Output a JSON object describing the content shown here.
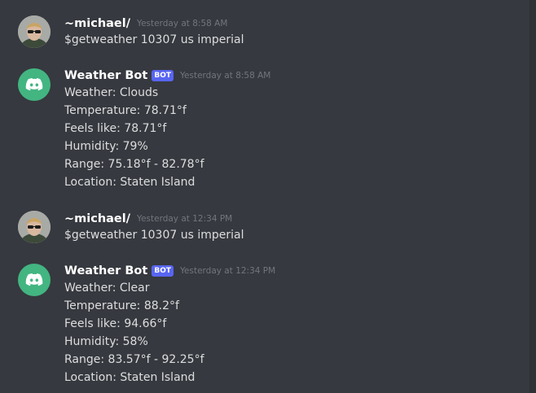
{
  "messages": [
    {
      "author": "~michael/",
      "timestamp": "Yesterday at 8:58 AM",
      "lines": [
        "$getweather 10307 us imperial"
      ]
    },
    {
      "author": "Weather Bot",
      "badge": "BOT",
      "timestamp": "Yesterday at 8:58 AM",
      "lines": [
        "Weather: Clouds",
        "Temperature: 78.71°f",
        "Feels like: 78.71°f",
        "Humidity: 79%",
        "Range: 75.18°f - 82.78°f",
        "Location: Staten Island"
      ]
    },
    {
      "author": "~michael/",
      "timestamp": "Yesterday at 12:34 PM",
      "lines": [
        "$getweather 10307 us imperial"
      ]
    },
    {
      "author": "Weather Bot",
      "badge": "BOT",
      "timestamp": "Yesterday at 12:34 PM",
      "lines": [
        "Weather: Clear",
        "Temperature: 88.2°f",
        "Feels like: 94.66°f",
        "Humidity: 58%",
        "Range: 83.57°f - 92.25°f",
        "Location: Staten Island"
      ]
    }
  ],
  "colors": {
    "background": "#36393f",
    "bot_avatar": "#43b581",
    "bot_badge": "#5865f2",
    "timestamp": "#72767d",
    "username": "#ffffff",
    "message_text": "#dcddde"
  },
  "icons": {
    "bot_avatar": "discord-logo-icon",
    "user_avatar": "user-photo-avatar"
  }
}
